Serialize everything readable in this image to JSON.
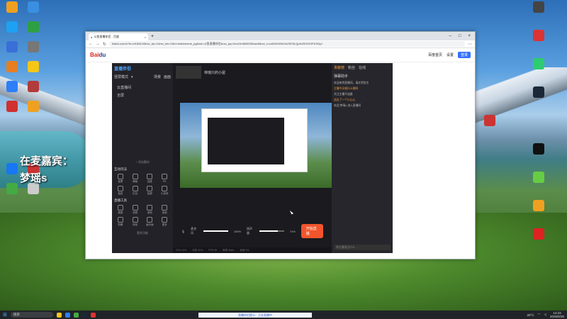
{
  "desktop": {
    "overlay_line1": "在麦嘉宾：",
    "overlay_line2": "梦瑶s",
    "icons_left": [
      {
        "name": "icon-1",
        "color": "#f0a020"
      },
      {
        "name": "icon-2",
        "color": "#3a8fe0"
      },
      {
        "name": "icon-3",
        "color": "#1ea1f2"
      },
      {
        "name": "icon-4",
        "color": "#2ea043"
      },
      {
        "name": "icon-5",
        "color": "#3a6fd8"
      },
      {
        "name": "icon-6",
        "color": "#777"
      },
      {
        "name": "icon-7",
        "color": "#e67e22"
      },
      {
        "name": "icon-8",
        "color": "#f5c518"
      },
      {
        "name": "icon-9",
        "color": "#2d7ff9"
      },
      {
        "name": "icon-10",
        "color": "#b23b3b"
      },
      {
        "name": "icon-11",
        "color": "#d03030"
      },
      {
        "name": "icon-12",
        "color": "#f0a020"
      },
      {
        "name": "icon-13",
        "color": "#1877f2"
      },
      {
        "name": "icon-14",
        "color": "#cc3333"
      },
      {
        "name": "icon-15",
        "color": "#4a4"
      },
      {
        "name": "icon-16",
        "color": "#ccc"
      }
    ],
    "icons_right": [
      {
        "name": "icon-r1",
        "color": "#444"
      },
      {
        "name": "icon-r2",
        "color": "#d33"
      },
      {
        "name": "icon-r3",
        "color": "#2ecc71"
      },
      {
        "name": "icon-r4",
        "color": "#1b2838"
      },
      {
        "name": "icon-r5",
        "color": "#c33"
      },
      {
        "name": "icon-r6",
        "color": "#111"
      },
      {
        "name": "icon-r7",
        "color": "#6c4"
      },
      {
        "name": "icon-r8",
        "color": "#f0a020"
      },
      {
        "name": "icon-r9",
        "color": "#d22"
      }
    ]
  },
  "browser": {
    "tab_title": "斗鱼直播伴侣 - 百度",
    "url": "baidu.com/s?ie=utf-8&f=8&rsv_bp=1&rsv_idx=1&tn=baiduhome_pg&wd=斗鱼直播伴侣&rsv_pq=0xc41b4606000cae8&rsv_t=ca923e92fcSA25C5LQpfc39OGt3F4Ot0yJ",
    "site_links": [
      "百度首页",
      "设置"
    ],
    "login_label": "登录"
  },
  "app": {
    "brand": "直播伴侣",
    "room_title": "林瑶只的小屋",
    "left_header": "竖屏模式",
    "left_tabs": [
      "场景",
      "画面"
    ],
    "scene_items": [
      "云直播间",
      "全屏"
    ],
    "add_source": "+ 添加素材",
    "interaction_title": "互动玩法",
    "interaction_items": [
      "投票",
      "弹幕",
      "连麦",
      "PK",
      "抽奖",
      "红包",
      "投屏",
      "小游戏"
    ],
    "tools_title": "直播工具",
    "tools_items": [
      "美颜",
      "滤镜",
      "音效",
      "录制",
      "剪辑",
      "特效",
      "画中画",
      "更多"
    ],
    "more": "更多功能",
    "mic_label": "麦克风",
    "mic_value": "100%",
    "speaker_label": "扬声器",
    "speaker_value": "74%",
    "start_live": "开始直播",
    "statusbar": [
      "CPU 12%",
      "内存 42%",
      "FPS 30",
      "码率 0kb/s",
      "丢帧 0%"
    ],
    "right_tabs": [
      "贡献榜",
      "粉丝",
      "在线"
    ],
    "chat_title": "弹幕助手",
    "chat_messages": [
      {
        "text": "欢迎来到直播间，请文明发言",
        "highlight": false
      },
      {
        "text": "主播今天唱什么歌呀",
        "highlight": true
      },
      {
        "text": "关注主播不迷路",
        "highlight": false
      },
      {
        "text": "送出了一个小心心",
        "highlight": true
      },
      {
        "text": "欢迎 梦瑶s 进入直播间",
        "highlight": false
      }
    ],
    "chat_input_placeholder": "和主播说点什么..."
  },
  "taskbar": {
    "search_placeholder": "搜索",
    "weather": "26°C",
    "time": "14:23",
    "date": "2025/6/30",
    "toast": "直播伴侣提示：正在直播中"
  }
}
